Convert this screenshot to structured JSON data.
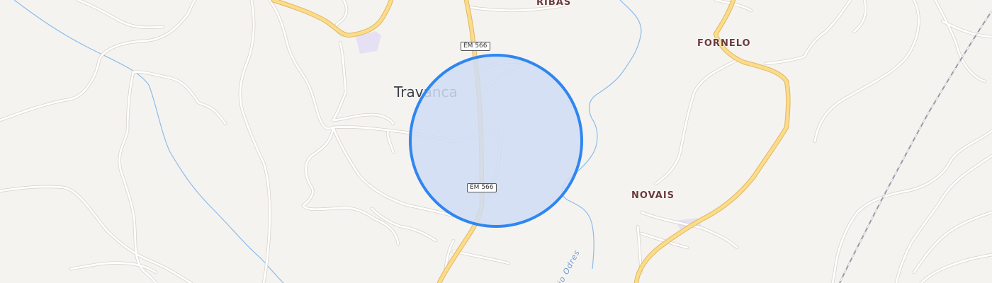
{
  "map": {
    "place_name": "Travanca",
    "villages": [
      "RIBAS",
      "FORNELO",
      "NOVAIS"
    ],
    "road_shields": [
      "EM 566",
      "EM 566"
    ],
    "river_name": "io Odres",
    "colors": {
      "background": "#f5f3f0",
      "minor_road": "#ffffff",
      "minor_road_casing": "#d9d4cc",
      "main_road": "#fbdc8a",
      "main_road_casing": "#e0b860",
      "river": "#8cbce8",
      "railway": "#9a9aa6",
      "area_highlight": "#e6e0f5",
      "search_circle_fill": "#cfdcf4",
      "search_circle_stroke": "#2f86f0"
    }
  }
}
